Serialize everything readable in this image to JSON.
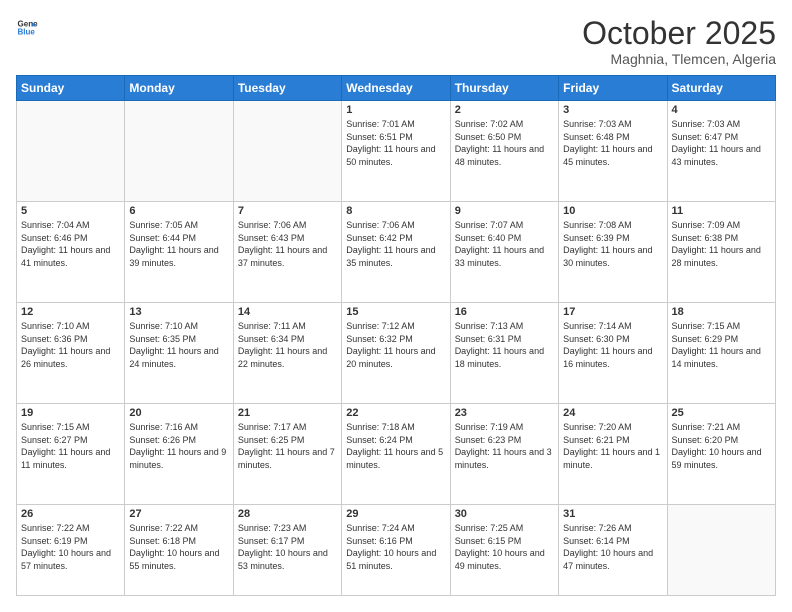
{
  "logo": {
    "line1": "General",
    "line2": "Blue"
  },
  "header": {
    "month": "October 2025",
    "location": "Maghnia, Tlemcen, Algeria"
  },
  "days": [
    "Sunday",
    "Monday",
    "Tuesday",
    "Wednesday",
    "Thursday",
    "Friday",
    "Saturday"
  ],
  "weeks": [
    [
      {
        "day": null,
        "text": ""
      },
      {
        "day": null,
        "text": ""
      },
      {
        "day": null,
        "text": ""
      },
      {
        "day": "1",
        "text": "Sunrise: 7:01 AM\nSunset: 6:51 PM\nDaylight: 11 hours and 50 minutes."
      },
      {
        "day": "2",
        "text": "Sunrise: 7:02 AM\nSunset: 6:50 PM\nDaylight: 11 hours and 48 minutes."
      },
      {
        "day": "3",
        "text": "Sunrise: 7:03 AM\nSunset: 6:48 PM\nDaylight: 11 hours and 45 minutes."
      },
      {
        "day": "4",
        "text": "Sunrise: 7:03 AM\nSunset: 6:47 PM\nDaylight: 11 hours and 43 minutes."
      }
    ],
    [
      {
        "day": "5",
        "text": "Sunrise: 7:04 AM\nSunset: 6:46 PM\nDaylight: 11 hours and 41 minutes."
      },
      {
        "day": "6",
        "text": "Sunrise: 7:05 AM\nSunset: 6:44 PM\nDaylight: 11 hours and 39 minutes."
      },
      {
        "day": "7",
        "text": "Sunrise: 7:06 AM\nSunset: 6:43 PM\nDaylight: 11 hours and 37 minutes."
      },
      {
        "day": "8",
        "text": "Sunrise: 7:06 AM\nSunset: 6:42 PM\nDaylight: 11 hours and 35 minutes."
      },
      {
        "day": "9",
        "text": "Sunrise: 7:07 AM\nSunset: 6:40 PM\nDaylight: 11 hours and 33 minutes."
      },
      {
        "day": "10",
        "text": "Sunrise: 7:08 AM\nSunset: 6:39 PM\nDaylight: 11 hours and 30 minutes."
      },
      {
        "day": "11",
        "text": "Sunrise: 7:09 AM\nSunset: 6:38 PM\nDaylight: 11 hours and 28 minutes."
      }
    ],
    [
      {
        "day": "12",
        "text": "Sunrise: 7:10 AM\nSunset: 6:36 PM\nDaylight: 11 hours and 26 minutes."
      },
      {
        "day": "13",
        "text": "Sunrise: 7:10 AM\nSunset: 6:35 PM\nDaylight: 11 hours and 24 minutes."
      },
      {
        "day": "14",
        "text": "Sunrise: 7:11 AM\nSunset: 6:34 PM\nDaylight: 11 hours and 22 minutes."
      },
      {
        "day": "15",
        "text": "Sunrise: 7:12 AM\nSunset: 6:32 PM\nDaylight: 11 hours and 20 minutes."
      },
      {
        "day": "16",
        "text": "Sunrise: 7:13 AM\nSunset: 6:31 PM\nDaylight: 11 hours and 18 minutes."
      },
      {
        "day": "17",
        "text": "Sunrise: 7:14 AM\nSunset: 6:30 PM\nDaylight: 11 hours and 16 minutes."
      },
      {
        "day": "18",
        "text": "Sunrise: 7:15 AM\nSunset: 6:29 PM\nDaylight: 11 hours and 14 minutes."
      }
    ],
    [
      {
        "day": "19",
        "text": "Sunrise: 7:15 AM\nSunset: 6:27 PM\nDaylight: 11 hours and 11 minutes."
      },
      {
        "day": "20",
        "text": "Sunrise: 7:16 AM\nSunset: 6:26 PM\nDaylight: 11 hours and 9 minutes."
      },
      {
        "day": "21",
        "text": "Sunrise: 7:17 AM\nSunset: 6:25 PM\nDaylight: 11 hours and 7 minutes."
      },
      {
        "day": "22",
        "text": "Sunrise: 7:18 AM\nSunset: 6:24 PM\nDaylight: 11 hours and 5 minutes."
      },
      {
        "day": "23",
        "text": "Sunrise: 7:19 AM\nSunset: 6:23 PM\nDaylight: 11 hours and 3 minutes."
      },
      {
        "day": "24",
        "text": "Sunrise: 7:20 AM\nSunset: 6:21 PM\nDaylight: 11 hours and 1 minute."
      },
      {
        "day": "25",
        "text": "Sunrise: 7:21 AM\nSunset: 6:20 PM\nDaylight: 10 hours and 59 minutes."
      }
    ],
    [
      {
        "day": "26",
        "text": "Sunrise: 7:22 AM\nSunset: 6:19 PM\nDaylight: 10 hours and 57 minutes."
      },
      {
        "day": "27",
        "text": "Sunrise: 7:22 AM\nSunset: 6:18 PM\nDaylight: 10 hours and 55 minutes."
      },
      {
        "day": "28",
        "text": "Sunrise: 7:23 AM\nSunset: 6:17 PM\nDaylight: 10 hours and 53 minutes."
      },
      {
        "day": "29",
        "text": "Sunrise: 7:24 AM\nSunset: 6:16 PM\nDaylight: 10 hours and 51 minutes."
      },
      {
        "day": "30",
        "text": "Sunrise: 7:25 AM\nSunset: 6:15 PM\nDaylight: 10 hours and 49 minutes."
      },
      {
        "day": "31",
        "text": "Sunrise: 7:26 AM\nSunset: 6:14 PM\nDaylight: 10 hours and 47 minutes."
      },
      {
        "day": null,
        "text": ""
      }
    ]
  ]
}
